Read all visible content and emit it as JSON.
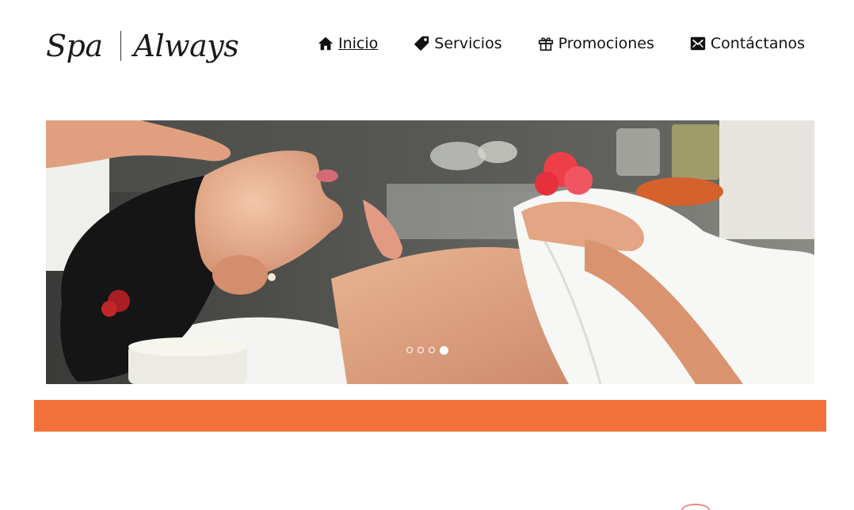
{
  "brand": {
    "part1": "Spa",
    "part2": "Always"
  },
  "nav": {
    "items": [
      {
        "label": "Inicio",
        "icon": "home-icon",
        "active": true
      },
      {
        "label": "Servicios",
        "icon": "tag-icon",
        "active": false
      },
      {
        "label": "Promociones",
        "icon": "gift-icon",
        "active": false
      },
      {
        "label": "Contáctanos",
        "icon": "envelope-icon",
        "active": false
      }
    ]
  },
  "slider": {
    "slide_count": 4,
    "active_slide": 4
  },
  "colors": {
    "accent": "#f3713a",
    "text": "#111111",
    "background": "#ffffff"
  }
}
